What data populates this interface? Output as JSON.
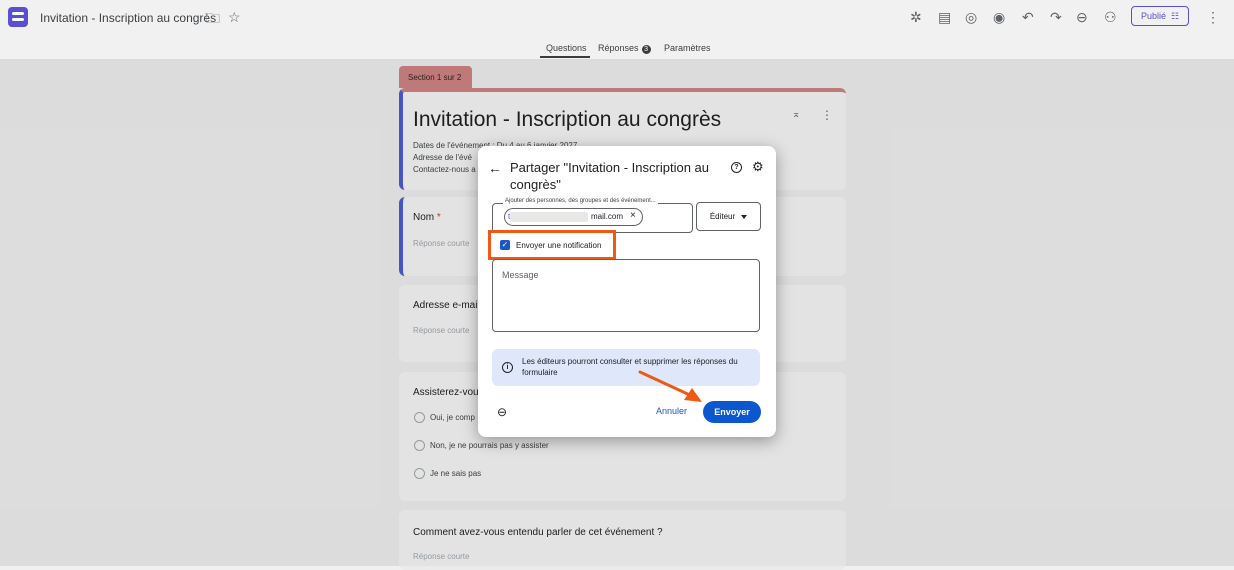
{
  "app": {
    "doc_title": "Invitation - Inscription au congrès",
    "publish_label": "Publié",
    "accent": "#5a4fd0"
  },
  "tabs": [
    {
      "label": "Questions"
    },
    {
      "label": "Réponses",
      "badge": "3"
    },
    {
      "label": "Paramètres"
    }
  ],
  "form": {
    "section_label": "Section 1 sur 2",
    "title": "Invitation - Inscription au congrès",
    "description_lines": [
      "Dates de l'événement : Du 4 au 6 janvier 2027",
      "Adresse de l'évé",
      "Contactez-nous a"
    ],
    "questions": [
      {
        "title": "Nom",
        "required": "*",
        "hint": "Réponse courte"
      },
      {
        "title": "Adresse e-mail",
        "hint": "Réponse courte"
      },
      {
        "title": "Assisterez-vous",
        "options": [
          "Oui, je comp",
          "Non, je ne pourrais pas y assister",
          "Je ne sais pas"
        ]
      },
      {
        "title": "Comment avez-vous entendu parler de cet événement ?",
        "hint": "Réponse courte"
      }
    ]
  },
  "share_dialog": {
    "title": "Partager \"Invitation - Inscription au congrès\"",
    "people_field_label": "Ajouter des personnes, des groupes et des événement...",
    "chip_prefix": "t",
    "chip_email_suffix": "mail.com",
    "role": "Éditeur",
    "notify_label": "Envoyer une notification",
    "notify_checked": true,
    "message_placeholder": "Message",
    "info_text": "Les éditeurs pourront consulter et supprimer les réponses du formulaire",
    "cancel_label": "Annuler",
    "send_label": "Envoyer"
  },
  "colors": {
    "highlight": "#ee5a16",
    "primary_button": "#0b57d0",
    "info_bg": "#dfe8fb"
  }
}
